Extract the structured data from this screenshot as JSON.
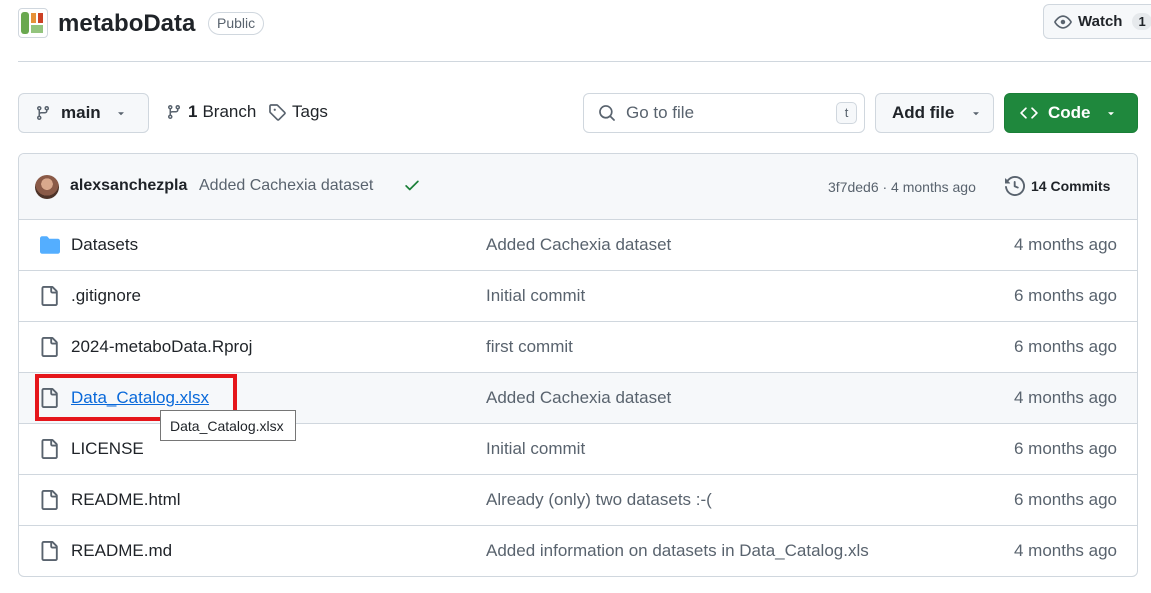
{
  "header": {
    "repo_name": "metaboData",
    "visibility": "Public",
    "watch_label": "Watch",
    "watch_count": "1"
  },
  "toolbar": {
    "branch": "main",
    "branch_count": "1",
    "branch_label": "Branch",
    "tags_label": "Tags",
    "search_placeholder": "Go to file",
    "search_shortcut": "t",
    "add_file_label": "Add file",
    "code_label": "Code"
  },
  "latest_commit": {
    "author": "alexsanchezpla",
    "message": "Added Cachexia dataset",
    "sha_time": "3f7ded6 · 4 months ago",
    "commits_label": "14 Commits"
  },
  "files": [
    {
      "name": "Datasets",
      "type": "folder",
      "message": "Added Cachexia dataset",
      "time": "4 months ago"
    },
    {
      "name": ".gitignore",
      "type": "file",
      "message": "Initial commit",
      "time": "6 months ago"
    },
    {
      "name": "2024-metaboData.Rproj",
      "type": "file",
      "message": "first commit",
      "time": "6 months ago"
    },
    {
      "name": "Data_Catalog.xlsx",
      "type": "file",
      "message": "Added Cachexia dataset",
      "time": "4 months ago"
    },
    {
      "name": "LICENSE",
      "type": "file",
      "message": "Initial commit",
      "time": "6 months ago"
    },
    {
      "name": "README.html",
      "type": "file",
      "message": "Already (only) two datasets :-(",
      "time": "6 months ago"
    },
    {
      "name": "README.md",
      "type": "file",
      "message": "Added information on datasets in Data_Catalog.xls",
      "time": "4 months ago"
    }
  ],
  "tooltip": "Data_Catalog.xlsx",
  "colors": {
    "accent_green": "#1f883d",
    "link_blue": "#0969da",
    "folder_blue": "#54aeff",
    "highlight_red": "#e5161b"
  }
}
